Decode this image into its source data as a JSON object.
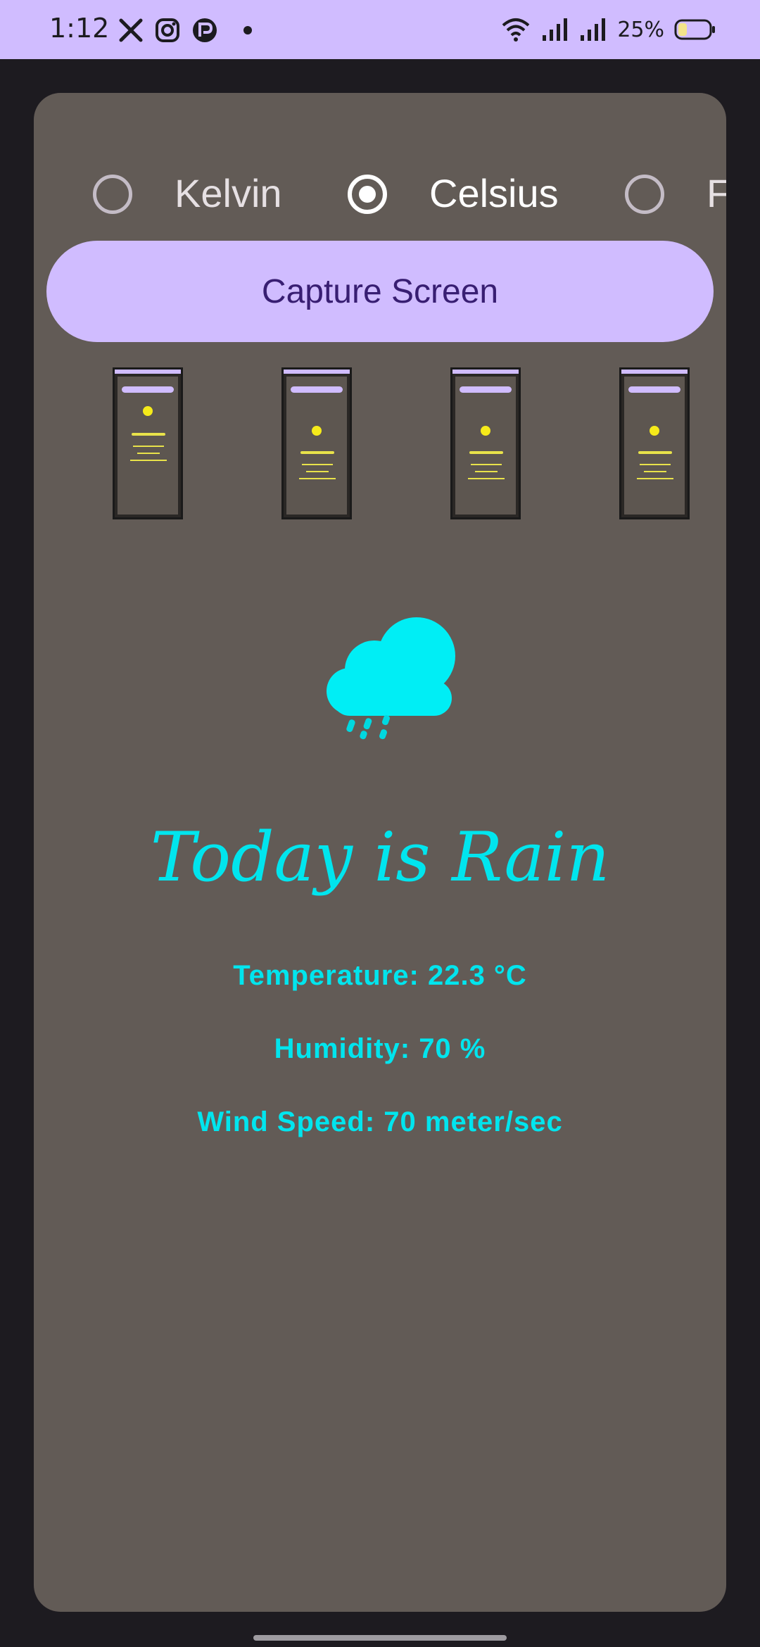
{
  "status_bar": {
    "time": "1:12",
    "battery": "25%",
    "icons": [
      "x-icon",
      "instagram-icon",
      "threads-icon",
      "dot-icon",
      "wifi-icon",
      "signal-icon",
      "signal-icon",
      "battery-icon"
    ]
  },
  "units": {
    "options": [
      {
        "label": "Kelvin",
        "selected": false
      },
      {
        "label": "Celsius",
        "selected": true
      },
      {
        "label": "F",
        "selected": false
      }
    ]
  },
  "capture_button": {
    "label": "Capture Screen"
  },
  "weather": {
    "icon": "rain-cloud-icon",
    "headline": "Today is Rain",
    "temperature": "Temperature: 22.3 °C",
    "humidity": "Humidity: 70 %",
    "wind": "Wind Speed: 70 meter/sec"
  },
  "colors": {
    "accent": "#d0bcff",
    "on_accent": "#381e72",
    "card_bg": "#625b56",
    "page_bg": "#1d1b20",
    "text_cyan": "#00e5ee",
    "thumbnail_text": "#e8e24a"
  }
}
